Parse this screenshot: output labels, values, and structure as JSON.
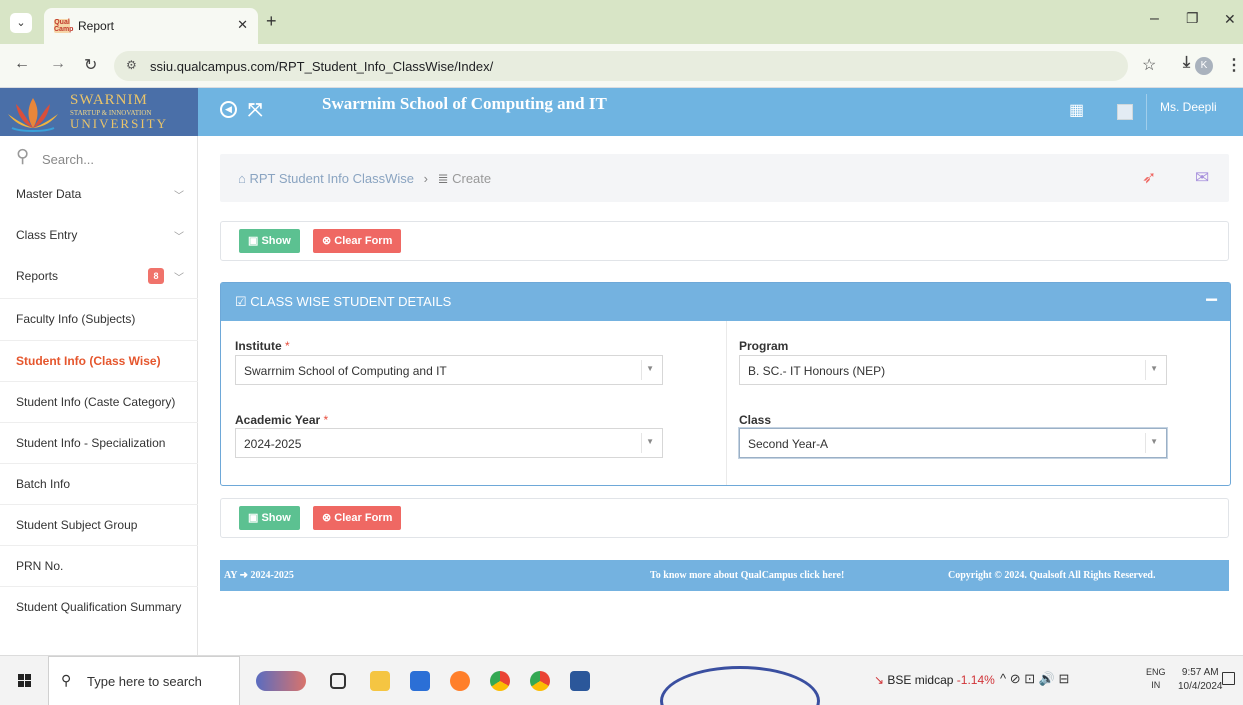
{
  "browser": {
    "tab_title": "Report",
    "favicon_text": "Qual Camp",
    "new_tab": "+",
    "url": "ssiu.qualcampus.com/RPT_Student_Info_ClassWise/Index/",
    "profile_initial": "K"
  },
  "header": {
    "logo_line1": "SWARNIM",
    "logo_line2": "STARTUP & INNOVATION",
    "logo_line3": "UNIVERSITY",
    "school_title": "Swarrnim School of Computing and IT",
    "user_name": "Ms. Deepli"
  },
  "sidebar": {
    "search_placeholder": "Search...",
    "reports_badge": "8",
    "items": [
      {
        "label": "Master Data"
      },
      {
        "label": "Class Entry"
      },
      {
        "label": "Reports"
      },
      {
        "label": "Faculty Info (Subjects)"
      },
      {
        "label": "Student Info (Class Wise)"
      },
      {
        "label": "Student Info (Caste Category)"
      },
      {
        "label": "Student Info - Specialization"
      },
      {
        "label": "Batch Info"
      },
      {
        "label": "Student Subject Group"
      },
      {
        "label": "PRN No."
      },
      {
        "label": "Student Qualification Summary"
      }
    ]
  },
  "breadcrumb": {
    "root": "RPT Student Info ClassWise",
    "current": "Create"
  },
  "buttons": {
    "show": "Show",
    "clear": "Clear Form"
  },
  "panel": {
    "title": "CLASS WISE STUDENT DETAILS",
    "collapse": "−",
    "fields": {
      "institute": {
        "label": "Institute",
        "required": "*",
        "value": "Swarrnim School of Computing and IT"
      },
      "program": {
        "label": "Program",
        "value": "B. SC.- IT Honours (NEP)"
      },
      "academic_year": {
        "label": "Academic Year",
        "required": "*",
        "value": "2024-2025"
      },
      "class": {
        "label": "Class",
        "value": "Second Year-A"
      }
    }
  },
  "footer": {
    "ay_label": "AY",
    "ay_value": "2024-2025",
    "know_more": "To know more about QualCampus click here!",
    "copyright": "Copyright © 2024. Qualsoft All Rights Reserved."
  },
  "taskbar": {
    "search_placeholder": "Type here to search",
    "stock_name": "BSE midcap",
    "stock_change": "-1.14%",
    "lang_line1": "ENG",
    "lang_line2": "IN",
    "time": "9:57 AM",
    "date": "10/4/2024"
  },
  "colors": {
    "header_bg": "#6fb4e1",
    "show_button": "#5cc191",
    "clear_button": "#ef6863",
    "active_menu": "#e5562d"
  }
}
